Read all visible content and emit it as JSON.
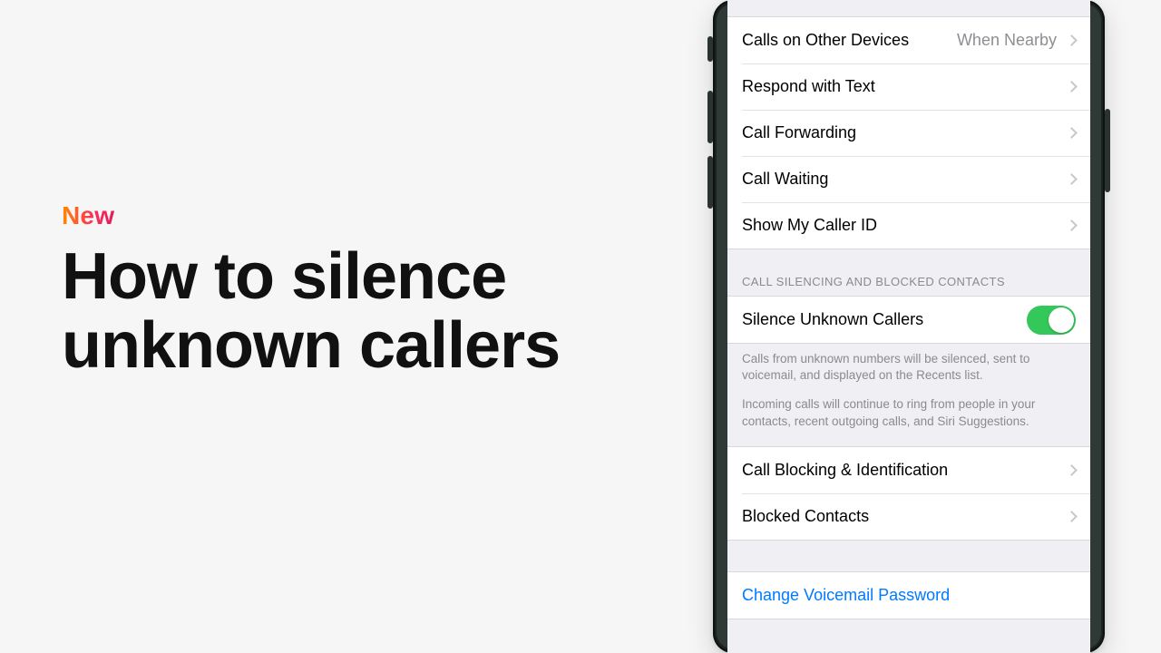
{
  "hero": {
    "badge": "New",
    "title_line1": "How to silence",
    "title_line2": "unknown callers"
  },
  "settings": {
    "group1": [
      {
        "label": "Calls on Other Devices",
        "value": "When Nearby"
      },
      {
        "label": "Respond with Text"
      },
      {
        "label": "Call Forwarding"
      },
      {
        "label": "Call Waiting"
      },
      {
        "label": "Show My Caller ID"
      }
    ],
    "silencing_header": "CALL SILENCING AND BLOCKED CONTACTS",
    "silence_row": {
      "label": "Silence Unknown Callers",
      "on": true
    },
    "silence_footer_p1": "Calls from unknown numbers will be silenced, sent to voicemail, and displayed on the Recents list.",
    "silence_footer_p2": "Incoming calls will continue to ring from people in your contacts, recent outgoing calls, and Siri Suggestions.",
    "group3": [
      {
        "label": "Call Blocking & Identification"
      },
      {
        "label": "Blocked Contacts"
      }
    ],
    "voicemail_row": {
      "label": "Change Voicemail Password"
    }
  }
}
